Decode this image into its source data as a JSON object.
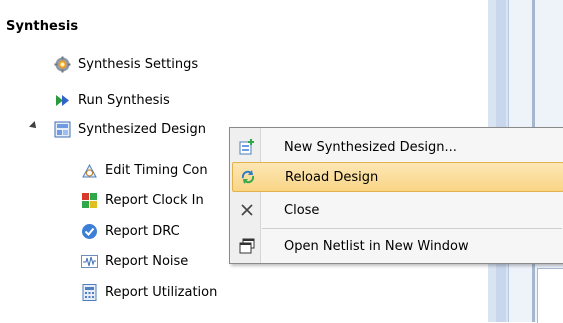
{
  "panel": {
    "heading": "Synthesis",
    "items": [
      {
        "label": "Synthesis Settings",
        "icon": "gear-icon"
      },
      {
        "label": "Run Synthesis",
        "icon": "run-arrow-icon"
      },
      {
        "label": "Synthesized Design",
        "icon": "design-icon"
      },
      {
        "label": "Edit Timing Con",
        "icon": "timing-icon"
      },
      {
        "label": "Report Clock In",
        "icon": "clock-report-icon"
      },
      {
        "label": "Report DRC",
        "icon": "drc-check-icon"
      },
      {
        "label": "Report Noise",
        "icon": "noise-icon"
      },
      {
        "label": "Report Utilization",
        "icon": "utilization-icon"
      }
    ]
  },
  "context_menu": {
    "items": [
      {
        "label": "New Synthesized Design...",
        "icon": "new-design-icon"
      },
      {
        "label": "Reload Design",
        "icon": "reload-icon",
        "highlighted": true
      },
      {
        "label": "Close",
        "icon": "close-icon"
      },
      {
        "label": "Open Netlist in New Window",
        "icon": "new-window-icon"
      }
    ]
  },
  "colors": {
    "highlight": "#fbd98c",
    "frame": "#d9e4f3"
  }
}
